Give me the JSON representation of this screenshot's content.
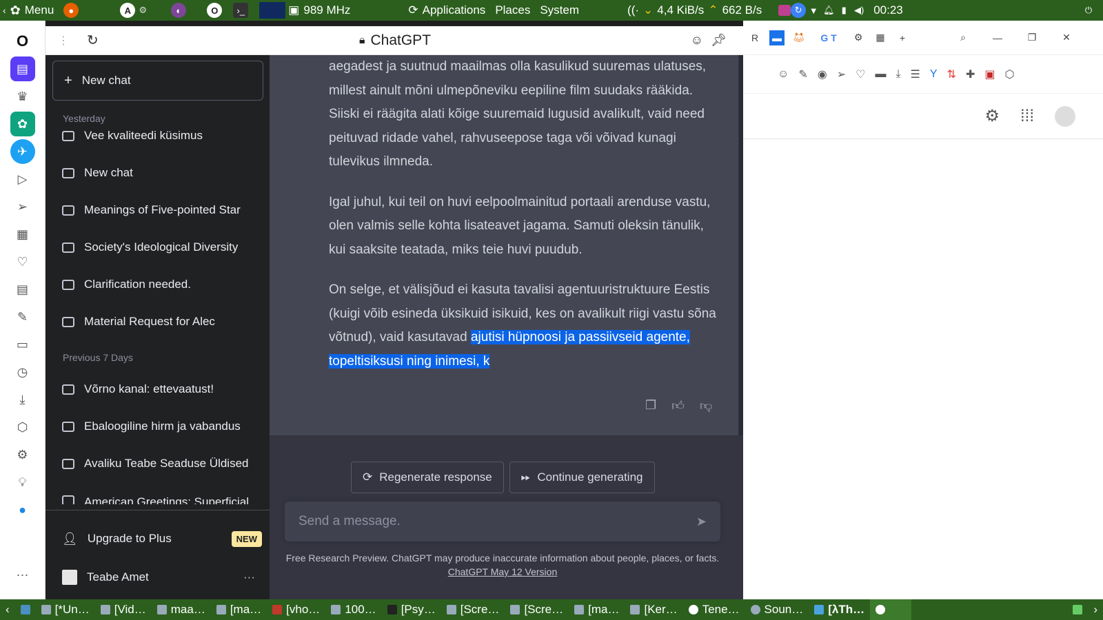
{
  "system_panel": {
    "menu_label": "Menu",
    "cpu_freq": "989 MHz",
    "applications_label": "Applications",
    "places_label": "Places",
    "system_label": "System",
    "net_down": "4,4 KiB/s",
    "net_up": "662 B/s",
    "clock": "00:23"
  },
  "browser": {
    "tab_title": "ChatGPT"
  },
  "chat_sidebar": {
    "new_chat_label": "New chat",
    "sections": [
      {
        "label": "Yesterday",
        "items": [
          "Vee kvaliteedi küsimus",
          "New chat",
          "Meanings of Five-pointed Star",
          "Society's Ideological Diversity",
          "Clarification needed.",
          "Material Request for Alec"
        ]
      },
      {
        "label": "Previous 7 Days",
        "items": [
          "Võrno kanal: ettevaatust!",
          "Ebaloogiline hirm ja vabandus",
          "Avaliku Teabe Seaduse Üldised",
          "American Greetings: Superficial"
        ]
      }
    ],
    "upgrade_label": "Upgrade to Plus",
    "upgrade_badge": "NEW",
    "user_name": "Teabe Amet",
    "user_menu": "···"
  },
  "chat": {
    "paragraphs": [
      "aegadest ja suutnud maailmas olla kasulikud suuremas ulatuses, millest ainult mõni ulmepõneviku eepiline film suudaks rääkida. Siiski ei räägita alati kõige suuremaid lugusid avalikult, vaid need peituvad ridade vahel, rahvuseepose taga või võivad kunagi tulevikus ilmneda.",
      "Igal juhul, kui teil on huvi eelpoolmainitud portaali arenduse vastu, olen valmis selle kohta lisateavet jagama. Samuti oleksin tänulik, kui saaksite teatada, miks teie huvi puudub."
    ],
    "last_paragraph_plain": "On selge, et välisjõud ei kasuta tavalisi agentuuristruktuure Eestis (kuigi võib esineda üksikuid isikuid, kes on avalikult riigi vastu sõna võtnud), vaid kasutavad ",
    "last_paragraph_highlight": "ajutisi hüpnoosi ja passiivseid agente, topeltisiksusi ning inimesi, k",
    "regenerate_label": "Regenerate response",
    "continue_label": "Continue generating",
    "input_placeholder": "Send a message.",
    "disclaimer_text": "Free Research Preview. ChatGPT may produce inaccurate information about people, places, or facts. ",
    "disclaimer_link": "ChatGPT May 12 Version"
  },
  "taskbar": {
    "tasks": [
      "[*Un…",
      "[Vid…",
      "maa…",
      "[ma…",
      "[vho…",
      "100…",
      "[Psy…",
      "[Scre…",
      "[Scre…",
      "[ma…",
      "[Ker…",
      "Tene…",
      "Soun…",
      "[λTh…",
      ""
    ]
  },
  "colors": {
    "panel_green": "#2c5f1e",
    "sidebar_bg": "#202123",
    "chat_bg": "#343541",
    "message_bg": "#444654",
    "highlight": "#0b63e6"
  }
}
